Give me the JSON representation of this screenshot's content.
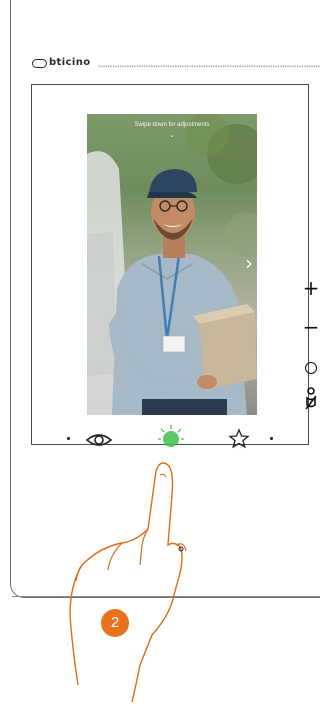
{
  "brand": {
    "logo_text": "bticino"
  },
  "screen": {
    "swipe_hint": "Swipe down for adjustments",
    "chevron": "⌄",
    "next_arrow": "›"
  },
  "side_controls": {
    "plus": "+",
    "minus": "−"
  },
  "bottom_buttons": [
    "eye-icon",
    "key-icon",
    "star-icon"
  ],
  "step_badge": "2",
  "colors": {
    "badge": "#e8731e",
    "key_led": "#3fbf4a",
    "hand_outline": "#e06a16"
  }
}
